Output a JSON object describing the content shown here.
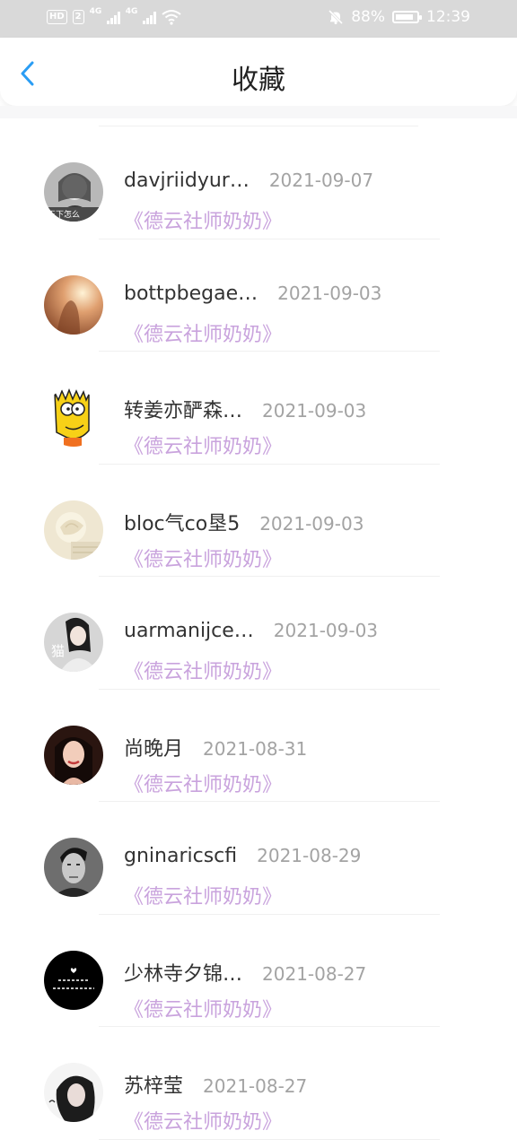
{
  "status_bar": {
    "hd": "HD",
    "sim": "2",
    "net1": "4G",
    "net2": "4G",
    "battery_percent": "88%",
    "battery_level": 0.88,
    "time": "12:39"
  },
  "header": {
    "title": "收藏"
  },
  "items": [
    {
      "name": "davjriidyur…",
      "date": "2021-09-07",
      "book": "《德云社师奶奶》",
      "avatar_caption": "王下怎么"
    },
    {
      "name": "bottpbegae…",
      "date": "2021-09-03",
      "book": "《德云社师奶奶》"
    },
    {
      "name": "转姜亦酽森…",
      "date": "2021-09-03",
      "book": "《德云社师奶奶》"
    },
    {
      "name": "bloc气co垦5",
      "date": "2021-09-03",
      "book": "《德云社师奶奶》"
    },
    {
      "name": "uarmanijce…",
      "date": "2021-09-03",
      "book": "《德云社师奶奶》",
      "avatar_caption": "猫"
    },
    {
      "name": "尚晚月",
      "date": "2021-08-31",
      "book": "《德云社师奶奶》"
    },
    {
      "name": "gninaricscfi",
      "date": "2021-08-29",
      "book": "《德云社师奶奶》"
    },
    {
      "name": "少林寺夕锦…",
      "date": "2021-08-27",
      "book": "《德云社师奶奶》"
    },
    {
      "name": "苏梓莹",
      "date": "2021-08-27",
      "book": "《德云社师奶奶》"
    }
  ]
}
